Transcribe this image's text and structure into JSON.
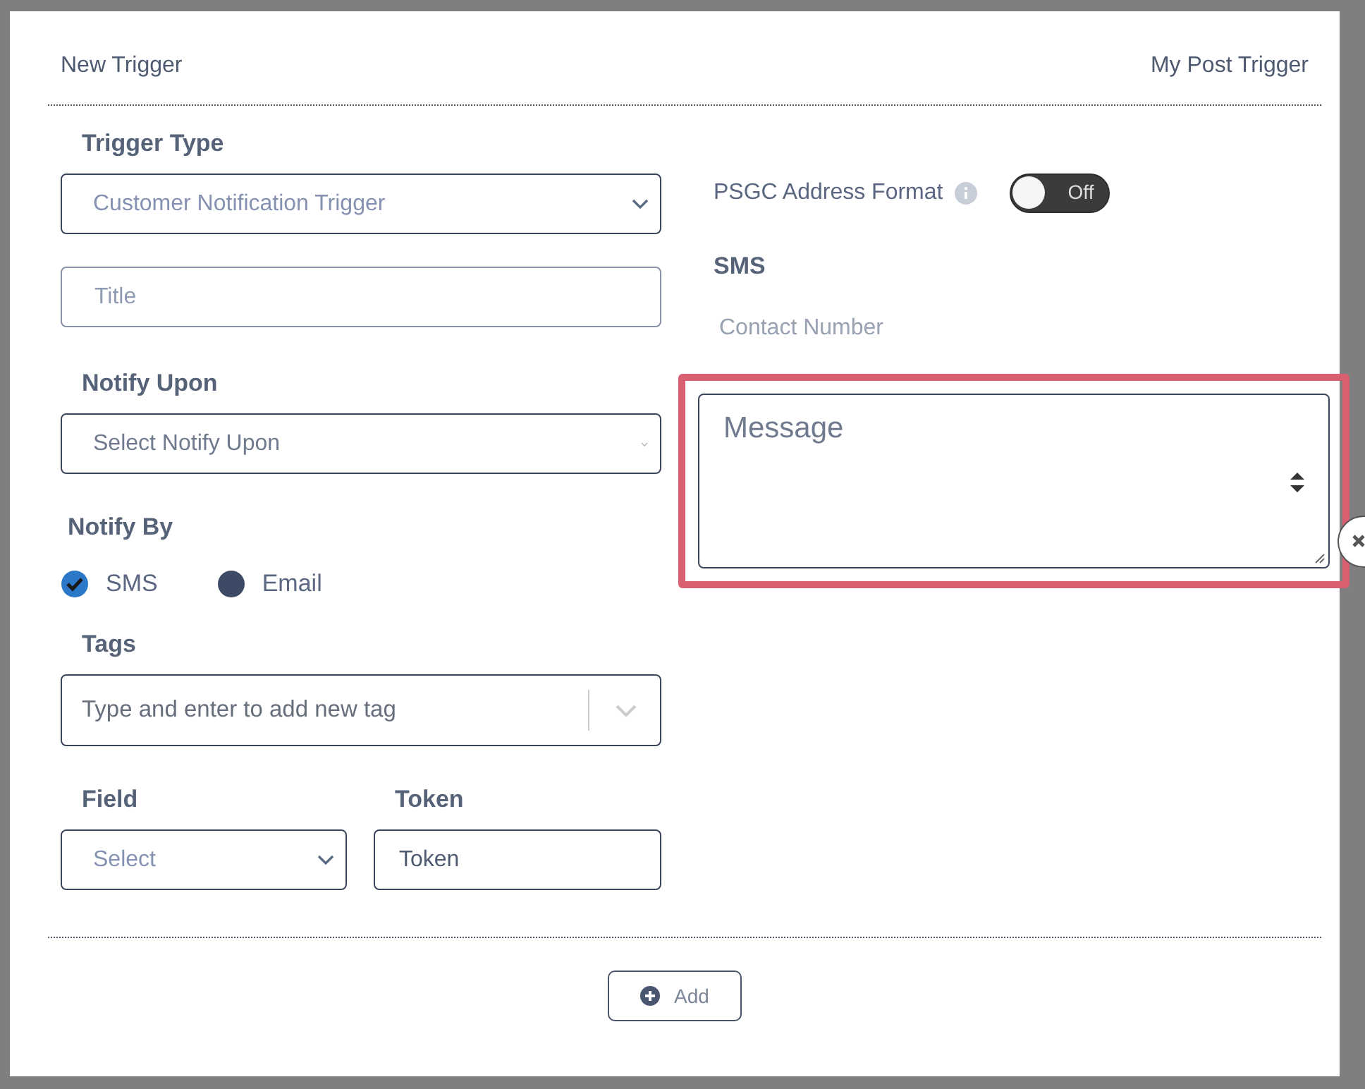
{
  "header": {
    "title": "New Trigger",
    "trigger_name": "My Post Trigger"
  },
  "trigger_type": {
    "label": "Trigger Type",
    "value": "Customer Notification Trigger"
  },
  "title_field": {
    "placeholder": "Title"
  },
  "notify_upon": {
    "label": "Notify Upon",
    "placeholder": "Select Notify Upon"
  },
  "notify_by": {
    "label": "Notify By",
    "options": [
      {
        "label": "SMS",
        "checked": true
      },
      {
        "label": "Email",
        "checked": false
      }
    ]
  },
  "tags": {
    "label": "Tags",
    "placeholder": "Type and enter to add new tag"
  },
  "field": {
    "label": "Field",
    "placeholder": "Select"
  },
  "token": {
    "label": "Token",
    "value": "Token"
  },
  "psgc": {
    "label": "PSGC Address Format",
    "on": false,
    "state_text": "Off"
  },
  "sms": {
    "heading": "SMS",
    "contact_placeholder": "Contact Number",
    "message_placeholder": "Message",
    "highlighted": true
  },
  "add_button": "Add"
}
